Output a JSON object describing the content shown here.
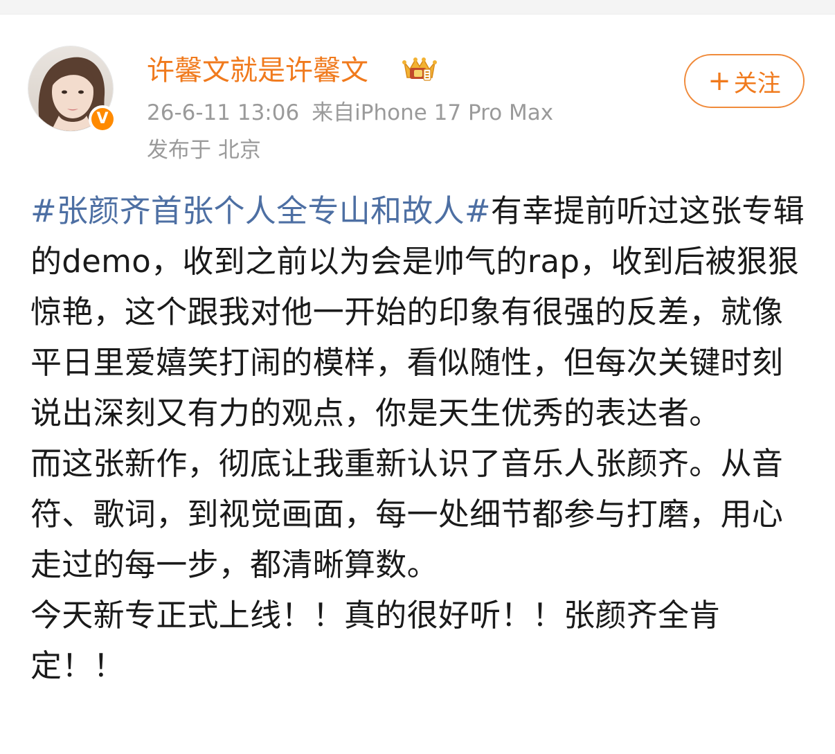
{
  "user": {
    "name": "许馨文就是许馨文",
    "verified_badge": "V",
    "crown_badge_icon": "crown-badge-icon"
  },
  "meta": {
    "time": "26-6-11 13:06",
    "source": "来自iPhone 17 Pro Max",
    "location": "发布于 北京"
  },
  "follow_button": {
    "plus": "+",
    "label": "关注"
  },
  "post": {
    "hashtag": "#张颜齐首张个人全专山和故人#",
    "paragraph1_after_tag": "有幸提前听过这张专辑的demo，收到之前以为会是帅气的rap，收到后被狠狠惊艳，这个跟我对他一开始的印象有很强的反差，就像平日里爱嬉笑打闹的模样，看似随性，但每次关键时刻说出深刻又有力的观点，你是天生优秀的表达者。",
    "paragraph2": "而这张新作，彻底让我重新认识了音乐人张颜齐。从音符、歌词，到视觉画面，每一处细节都参与打磨，用心走过的每一步，都清晰算数。",
    "paragraph3": "今天新专正式上线！！真的很好听！！张颜齐全肯定！！"
  },
  "colors": {
    "username": "#f07a1d",
    "hashtag": "#4d6fa3",
    "meta": "#9a9a9a",
    "badge": "#ff8a00",
    "text": "#1a1a1a"
  }
}
